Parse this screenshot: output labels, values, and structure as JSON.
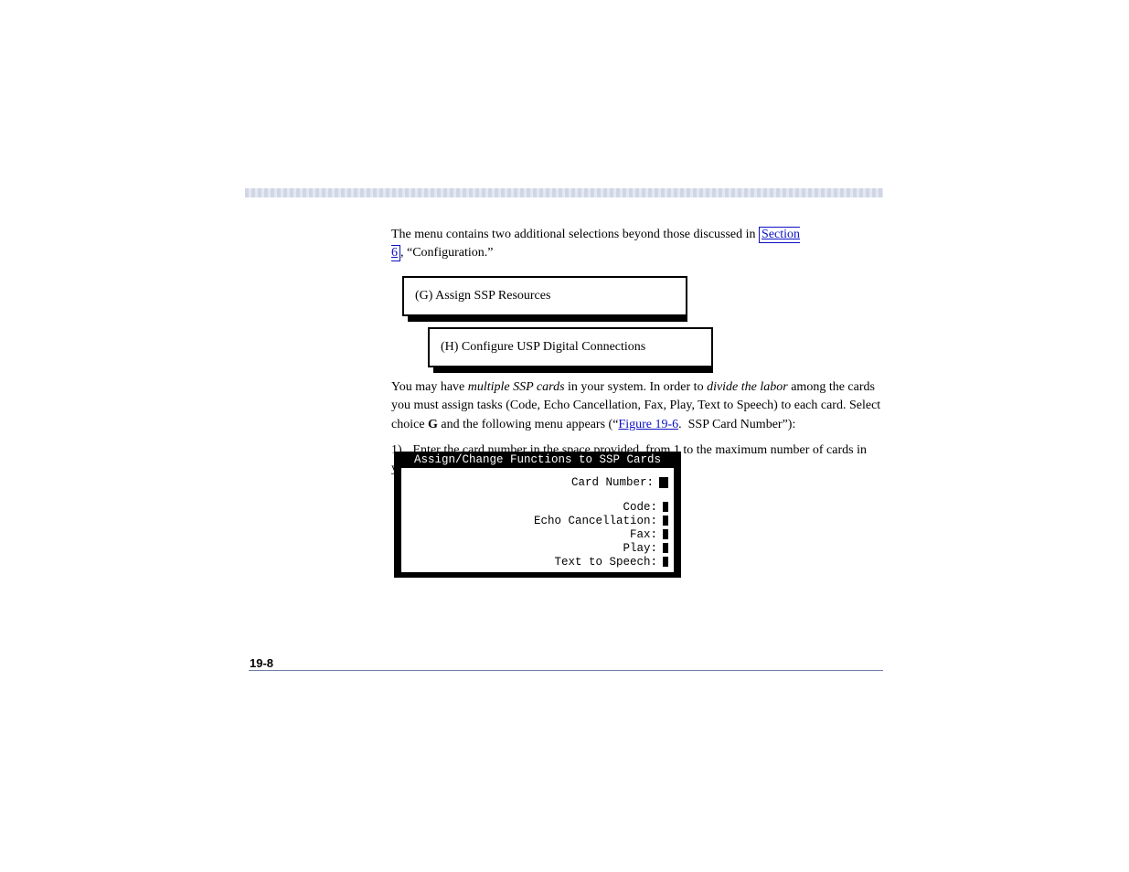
{
  "para1_pre": "The menu contains two additional selections beyond those discussed in\n",
  "section_link": "Section 6",
  "para1_post": ", “Configuration.”",
  "box1": "(G) Assign SSP Resources",
  "box2": "(H) Configure USP Digital Connections",
  "para2_pre": "You may have ",
  "para2_mid1": "multiple SSP cards",
  "para2_mid2": " in your system. In order to ",
  "para2_mid3": "divide the labor",
  "para2_mid4": "\namong the cards you must assign tasks (Code, Echo Cancellation, Fax, Play, Text to\nSpeech) to each card. Select choice ",
  "para2_g": "G",
  "para2_mid5": " and the following menu appears (“",
  "figure_link": "Figure 19-6",
  "para2_end": ". \nSSP Card Number”):",
  "step1_num": "1)",
  "step1_text": "Enter the card number in the space provided, from 1 to the maximum number\nof cards in your system. The following display appears:",
  "terminal": {
    "title": "Assign/Change Functions to SSP Cards",
    "card_number": "Card Number:",
    "code": "Code:",
    "echo": "Echo Cancellation:",
    "fax": "Fax:",
    "play": "Play:",
    "tts": "Text to Speech:"
  },
  "page_number": "19-8"
}
